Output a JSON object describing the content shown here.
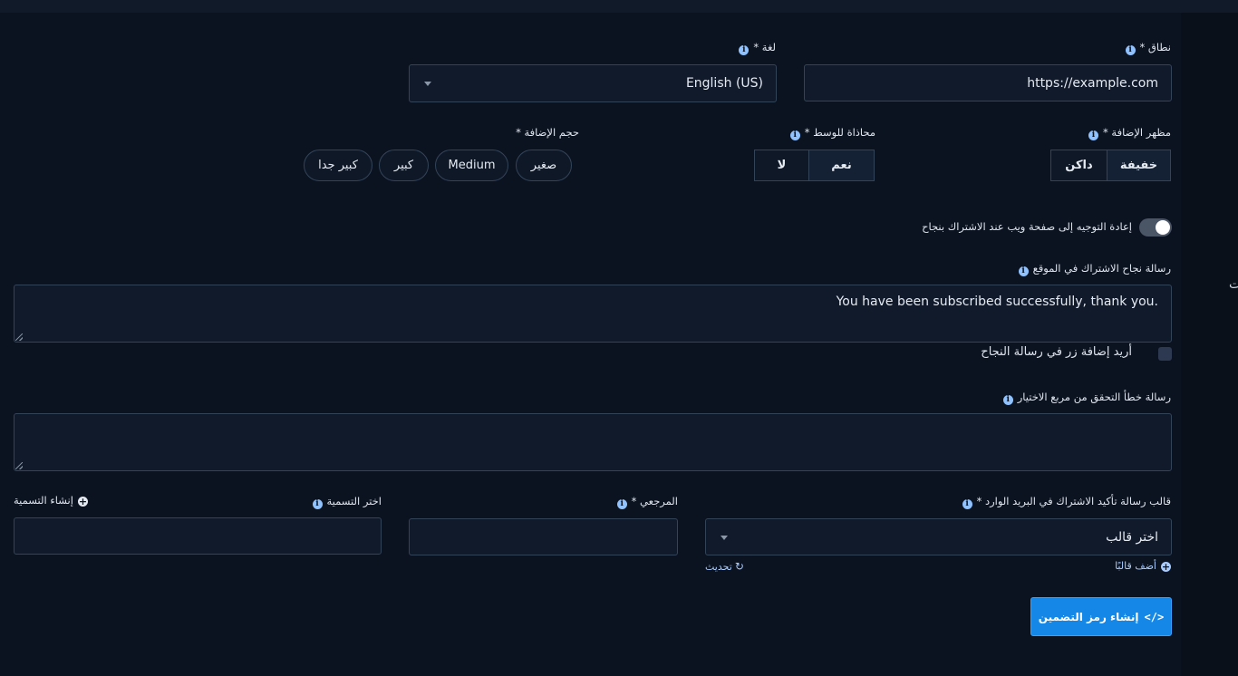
{
  "domain_field": {
    "label": "نطاق *",
    "value": "https://example.com"
  },
  "language_field": {
    "label": "لغة *",
    "value": "English (US)"
  },
  "appearance": {
    "label": "مظهر الإضافة *",
    "options": [
      "خفيفة",
      "داكن"
    ],
    "selected": "خفيفة"
  },
  "center_align": {
    "label": "محاذاة للوسط *",
    "options": [
      "نعم",
      "لا"
    ],
    "selected": "نعم"
  },
  "size": {
    "label": "حجم الإضافة *",
    "options": [
      "صغير",
      "Medium",
      "كبير",
      "كبير جدا"
    ]
  },
  "redirect_toggle": {
    "label": "إعادة التوجيه إلى صفحة ويب عند الاشتراك بنجاح",
    "on": true
  },
  "success_message": {
    "label": "رسالة نجاح الاشتراك في الموقع",
    "value": "You have been subscribed successfully, thank you."
  },
  "add_button_checkbox": {
    "label": "أريد إضافة زر في رسالة النجاح",
    "checked": false
  },
  "checkbox_error": {
    "label": "رسالة خطأ التحقق من مربع الاختيار",
    "value": ""
  },
  "template_field": {
    "label": "قالب رسالة تأكيد الاشتراك في البريد الوارد *",
    "value": "اختر قالب",
    "add_link": "أضف قالبًا",
    "refresh_link": "تحديث"
  },
  "reference_field": {
    "label": "المرجعي *",
    "value": ""
  },
  "tag_field": {
    "label": "اختر التسمية",
    "create_link": "إنشاء التسمية",
    "value": ""
  },
  "generate_button": {
    "label": "إنشاء رمز التضمين",
    "icon": "</>"
  },
  "side_fragment": "ت",
  "colors": {
    "accent": "#1587e6",
    "background": "#0c1320",
    "field": "#101a2b",
    "border": "#334459",
    "link": "#a9ccff"
  }
}
